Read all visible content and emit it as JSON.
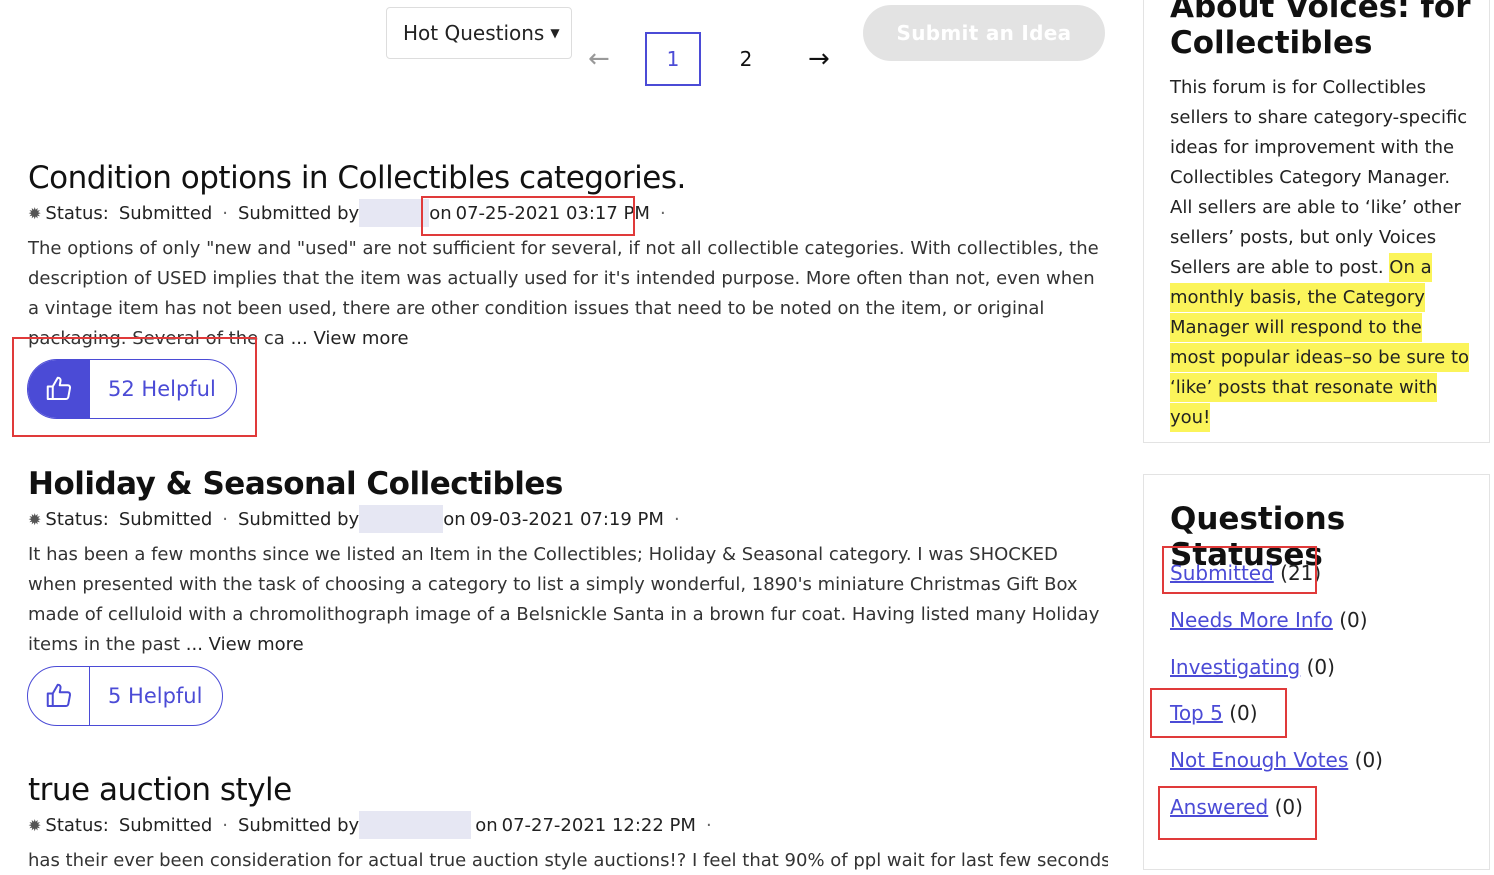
{
  "toolbar": {
    "sort_label": "Hot Questions",
    "prev_arrow": "←",
    "next_arrow": "→",
    "pages": [
      "1",
      "2"
    ],
    "current_page": "1",
    "submit_label": "Submit an Idea"
  },
  "posts": [
    {
      "title": "Condition options in Collectibles categories.",
      "status_label": "Status:",
      "status_value": "Submitted",
      "submitted_by_label": "Submitted by",
      "on_label": "on",
      "date": "07-25-2021 03:17 PM",
      "body": "The options of only \"new and \"used\" are not sufficient for several, if not all collectible categories. With collectibles, the description of USED implies that the item was actually used for it's intended purpose. More often than not, even when a vintage item has not been used, there are other condition issues that need to be noted on the item, or original packaging. Several of the ca",
      "view_more": "... View more",
      "helpful": "52 Helpful"
    },
    {
      "title": "Holiday & Seasonal Collectibles",
      "status_label": "Status:",
      "status_value": "Submitted",
      "submitted_by_label": "Submitted by",
      "on_label": "on",
      "date": "09-03-2021 07:19 PM",
      "body": "It has been a few months since we listed an Item in the Collectibles; Holiday & Seasonal category. I was SHOCKED when presented with the task of choosing a category to list a simply wonderful, 1890's miniature Christmas Gift Box made of celluloid with a chromolithograph image of a Belsnickle Santa in a brown fur coat. Having listed many Holiday items in the past",
      "view_more": "... View more",
      "helpful": "5 Helpful"
    },
    {
      "title": "true auction style",
      "status_label": "Status:",
      "status_value": "Submitted",
      "submitted_by_label": "Submitted by",
      "on_label": "on",
      "date": "07-27-2021 12:22 PM",
      "body": "has their ever been consideration for actual true auction style auctions!? I feel that 90% of ppl wait for last few seconds to make a"
    }
  ],
  "about": {
    "title": "About Voices: for Collectibles",
    "text_plain": "This forum is for Collectibles sellers to share category-specific ideas for improvement with the Collectibles Category Manager. All sellers are able to ‘like’ other sellers’ posts, but only Voices Sellers are able to post.",
    "text_highlight": "On a monthly basis, the Category Manager will respond to the most popular ideas–so be sure to ‘like’ posts that resonate with you!"
  },
  "statuses": {
    "title": "Questions Statuses",
    "items": [
      {
        "label": "Submitted",
        "count": "(21)"
      },
      {
        "label": "Needs More Info",
        "count": "(0)"
      },
      {
        "label": "Investigating",
        "count": "(0)"
      },
      {
        "label": "Top 5",
        "count": "(0)"
      },
      {
        "label": "Not Enough Votes",
        "count": "(0)"
      },
      {
        "label": "Answered",
        "count": "(0)"
      }
    ]
  },
  "colors": {
    "accent": "#4b4bd6",
    "highlight": "#fbf45a",
    "annotation_red": "#e03a3a",
    "disabled_button": "#e3e3e3"
  }
}
